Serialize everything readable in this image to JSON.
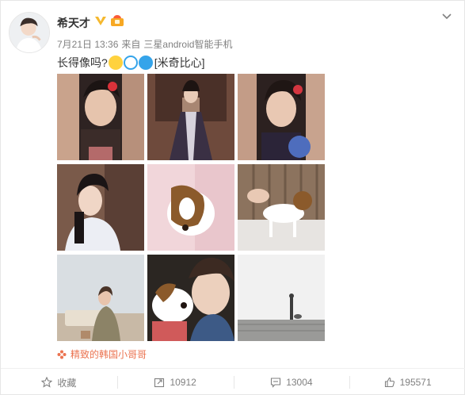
{
  "post": {
    "user_name": "希天才",
    "date": "7月21日 13:36",
    "source_prefix": "来自",
    "source_device": "三星android智能手机",
    "text": "长得像吗?",
    "emoji_label": "[米奇比心]",
    "topic": "精致的韩国小哥哥"
  },
  "actions": {
    "favorite_label": "收藏",
    "repost_count": "10912",
    "comment_count": "13004",
    "like_count": "195571"
  },
  "colors": {
    "accent_orange": "#eb7350",
    "vip_gold": "#f5b82e",
    "text_gray": "#808080"
  },
  "icons": [
    "avatar",
    "vip-badge-icon",
    "member-badge-icon",
    "chevron-down-icon",
    "flower-icon",
    "star-icon",
    "repost-icon",
    "comment-icon",
    "thumbs-up-icon"
  ]
}
